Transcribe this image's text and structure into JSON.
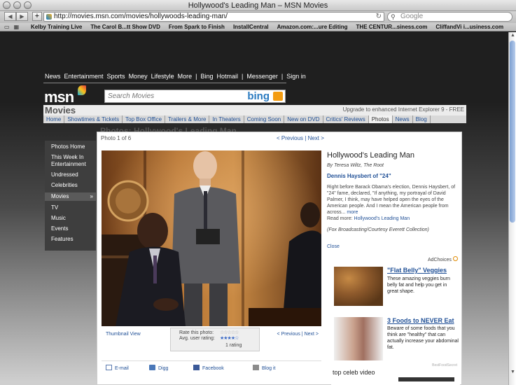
{
  "window": {
    "title": "Hollywood's Leading Man – MSN Movies"
  },
  "toolbar": {
    "url": "http://movies.msn.com/movies/hollywoods-leading-man/",
    "search_placeholder": "Google"
  },
  "bookmarks": [
    "Kelby Training Live",
    "The Carol B...tt Show DVD",
    "From Spark to Finish",
    "InstallCentral",
    "Amazon.com:...ure Editing",
    "THE CENTUR...siness.com",
    "CliffandVi i...usiness.com"
  ],
  "msn_nav": [
    "News",
    "Entertainment",
    "Sports",
    "Money",
    "Lifestyle",
    "More",
    "|",
    "Bing",
    "Hotmail",
    "|",
    "Messenger",
    "|",
    "Sign in"
  ],
  "search": {
    "placeholder": "Search Movies",
    "brand": "bing"
  },
  "movies": {
    "title": "Movies",
    "upgrade": "Upgrade to enhanced Internet Explorer 9 - FREE",
    "subnav": [
      "Home",
      "Showtimes & Tickets",
      "Top Box Office",
      "Trailers & More",
      "In Theaters",
      "Coming Soon",
      "New on DVD",
      "Critics' Reviews",
      "Photos",
      "News",
      "Blog"
    ]
  },
  "photos_heading": "Photos: Hollywood's Leading Man",
  "left_menu": [
    "Photos Home",
    "This Week In Entertainment",
    "Undressed",
    "Celebrities",
    "Movies",
    "TV",
    "Music",
    "Events",
    "Features"
  ],
  "gallery": {
    "count": "Photo 1 of 6",
    "prev": "< Previous",
    "sep": "|",
    "next": "Next >",
    "title": "Hollywood's Leading Man",
    "byline": "By Teresa Wiltz, The Root",
    "subhead": "Dennis Haysbert of \"24\"",
    "body": "Right before Barack Obama's election, Dennis Haysbert, of \"24\" fame, declared, \"If anything, my portrayal of David Palmer, I think, may have helped open the eyes of the American people. And I mean the American people from across...",
    "more": "more",
    "readmore_label": "Read more:",
    "readmore_link": "Hollywood's Leading Man",
    "credit": "(Fox Broadcasting/Courtesy Everett Collection)",
    "close": "Close",
    "thumbnail_view": "Thumbnail View",
    "rate_label": "Rate this photo:",
    "avg_label": "Avg. user rating:",
    "rating_count": "1 rating",
    "avg_rating": 4,
    "share": [
      "E-mail",
      "Digg",
      "Facebook",
      "Blog it"
    ]
  },
  "ad": {
    "choices": "AdChoices",
    "h1": "\"Flat Belly\" Veggies",
    "t1": "These amazing veggies burn belly fat and help you get in great shape.",
    "h2": "3 Foods to NEVER Eat",
    "t2": "Beware of some foods that you think are \"healthy\" that can actually increase your abdominal fat.",
    "source": "BestFoodSecret",
    "celeb": "top celeb video"
  },
  "colors": {
    "link": "#1f4f96",
    "accent": "#f39c12"
  }
}
